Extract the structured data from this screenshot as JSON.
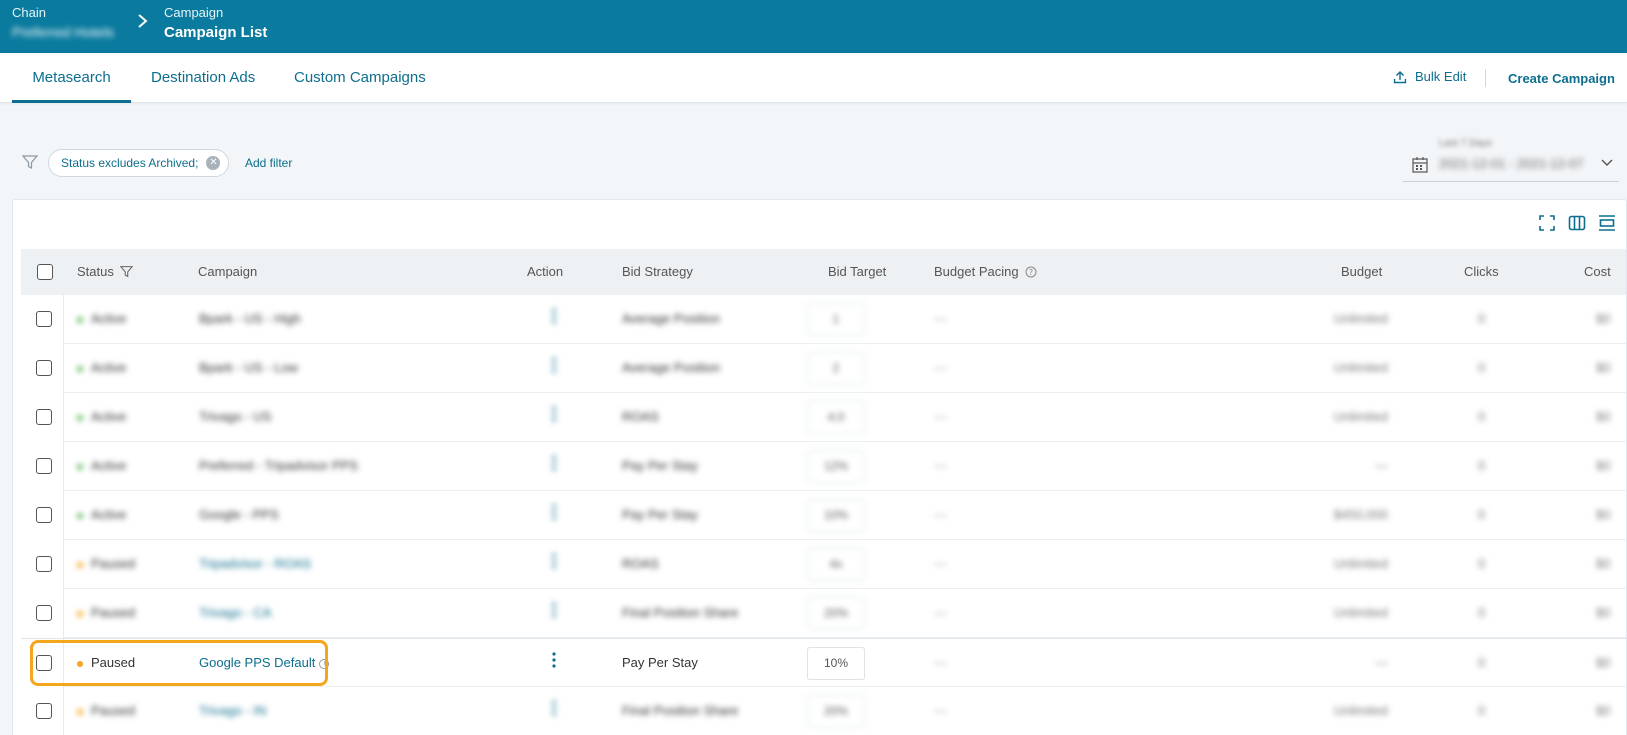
{
  "header": {
    "chain_label": "Chain",
    "chain_value": "Preferred Hotels",
    "campaign_label": "Campaign",
    "page_title": "Campaign List"
  },
  "tabs": [
    {
      "label": "Metasearch",
      "active": true
    },
    {
      "label": "Destination Ads",
      "active": false
    },
    {
      "label": "Custom Campaigns",
      "active": false
    }
  ],
  "actions": {
    "bulk_edit": "Bulk Edit",
    "create_campaign": "Create Campaign"
  },
  "filters": {
    "chip": "Status excludes Archived;",
    "add_filter": "Add filter"
  },
  "date_range": {
    "label": "Last 7 Days",
    "value": "2021-12-01 - 2021-12-07"
  },
  "columns": {
    "status": "Status",
    "campaign": "Campaign",
    "action": "Action",
    "bid_strategy": "Bid Strategy",
    "bid_target": "Bid Target",
    "budget_pacing": "Budget Pacing",
    "budget": "Budget",
    "clicks": "Clicks",
    "cost": "Cost"
  },
  "colors": {
    "brand": "#0a7a9e",
    "active_status": "#5cb85c",
    "paused_status": "#f4a61d",
    "highlight": "#f4a61d"
  },
  "rows": [
    {
      "status": "Active",
      "campaign": "Bpark - US - High",
      "bid_strategy": "Average Position",
      "bid_target": "1",
      "pacing": "—",
      "budget": "Unlimited",
      "clicks": "0",
      "cost": "$0"
    },
    {
      "status": "Active",
      "campaign": "Bpark - US - Low",
      "bid_strategy": "Average Position",
      "bid_target": "2",
      "pacing": "—",
      "budget": "Unlimited",
      "clicks": "0",
      "cost": "$0"
    },
    {
      "status": "Active",
      "campaign": "Trivago - US",
      "bid_strategy": "ROAS",
      "bid_target": "4.0",
      "pacing": "—",
      "budget": "Unlimited",
      "clicks": "0",
      "cost": "$0"
    },
    {
      "status": "Active",
      "campaign": "Preferred - Tripadvisor PPS",
      "bid_strategy": "Pay Per Stay",
      "bid_target": "12%",
      "pacing": "—",
      "budget": "—",
      "clicks": "0",
      "cost": "$0"
    },
    {
      "status": "Active",
      "campaign": "Google - PPS",
      "bid_strategy": "Pay Per Stay",
      "bid_target": "10%",
      "pacing": "—",
      "budget": "$450,000",
      "clicks": "0",
      "cost": "$0"
    },
    {
      "status": "Paused",
      "campaign": "Tripadvisor - ROAS",
      "bid_strategy": "ROAS",
      "bid_target": "4x",
      "pacing": "—",
      "budget": "Unlimited",
      "clicks": "0",
      "cost": "$0"
    },
    {
      "status": "Paused",
      "campaign": "Trivago - CA",
      "bid_strategy": "Final Position Share",
      "bid_target": "20%",
      "pacing": "—",
      "budget": "Unlimited",
      "clicks": "0",
      "cost": "$0"
    },
    {
      "status": "Paused",
      "campaign": "Google PPS Default",
      "bid_strategy": "Pay Per Stay",
      "bid_target": "10%",
      "pacing": "—",
      "budget": "—",
      "clicks": "0",
      "cost": "$0"
    },
    {
      "status": "Paused",
      "campaign": "Trivago - IN",
      "bid_strategy": "Final Position Share",
      "bid_target": "20%",
      "pacing": "—",
      "budget": "Unlimited",
      "clicks": "0",
      "cost": "$0"
    }
  ]
}
